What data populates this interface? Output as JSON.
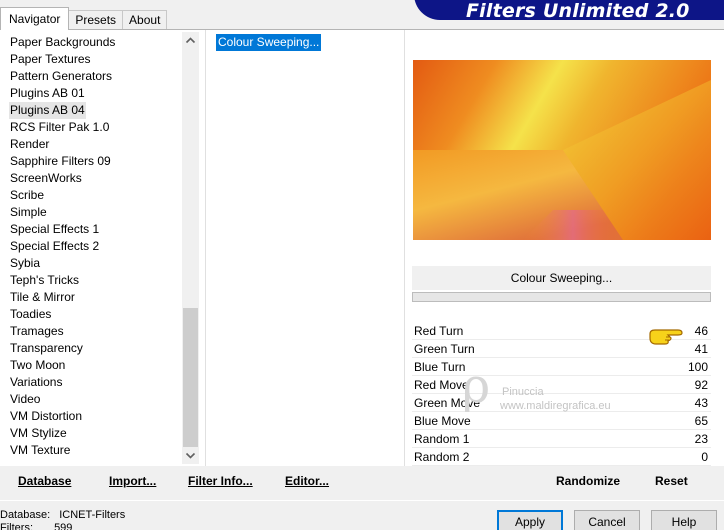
{
  "tabs": [
    {
      "label": "Navigator"
    },
    {
      "label": "Presets"
    },
    {
      "label": "About"
    }
  ],
  "banner": {
    "title": "Filters Unlimited 2.0",
    "color": "#0d1587"
  },
  "categories": [
    {
      "label": "Paper Backgrounds"
    },
    {
      "label": "Paper Textures"
    },
    {
      "label": "Pattern Generators"
    },
    {
      "label": "Plugins AB 01"
    },
    {
      "label": "Plugins AB 04",
      "selected": true
    },
    {
      "label": "RCS Filter Pak 1.0"
    },
    {
      "label": "Render"
    },
    {
      "label": "Sapphire Filters 09"
    },
    {
      "label": "ScreenWorks"
    },
    {
      "label": "Scribe"
    },
    {
      "label": "Simple"
    },
    {
      "label": "Special Effects 1"
    },
    {
      "label": "Special Effects 2"
    },
    {
      "label": "Sybia"
    },
    {
      "label": "Teph's Tricks"
    },
    {
      "label": "Tile & Mirror"
    },
    {
      "label": "Toadies"
    },
    {
      "label": "Tramages"
    },
    {
      "label": "Transparency"
    },
    {
      "label": "Two Moon"
    },
    {
      "label": "Variations"
    },
    {
      "label": "Video"
    },
    {
      "label": "VM Distortion"
    },
    {
      "label": "VM Stylize"
    },
    {
      "label": "VM Texture"
    }
  ],
  "filters": [
    {
      "label": "Colour Sweeping...",
      "selected": true
    }
  ],
  "preview": {
    "filter_name": "Colour Sweeping..."
  },
  "params": [
    {
      "label": "Red Turn",
      "value": "46"
    },
    {
      "label": "Green Turn",
      "value": "41"
    },
    {
      "label": "Blue Turn",
      "value": "100"
    },
    {
      "label": "Red Move",
      "value": "92"
    },
    {
      "label": "Green Move",
      "value": "43"
    },
    {
      "label": "Blue Move",
      "value": "65"
    },
    {
      "label": "Random 1",
      "value": "23"
    },
    {
      "label": "Random 2",
      "value": "0"
    }
  ],
  "watermark": {
    "name": "Pinuccia",
    "site": "www.maldiregrafica.eu"
  },
  "buttons": {
    "database": "Database",
    "import": "Import...",
    "filter_info": "Filter Info...",
    "editor": "Editor...",
    "randomize": "Randomize",
    "reset": "Reset",
    "apply": "Apply",
    "cancel": "Cancel",
    "help": "Help"
  },
  "footer": {
    "database_label": "Database:",
    "database_value": "ICNET-Filters",
    "filters_label": "Filters:",
    "filters_value": "599"
  },
  "icons": {
    "scroll_up": "chevron-up-icon",
    "scroll_down": "chevron-down-icon",
    "pointer": "pointing-hand-icon"
  }
}
